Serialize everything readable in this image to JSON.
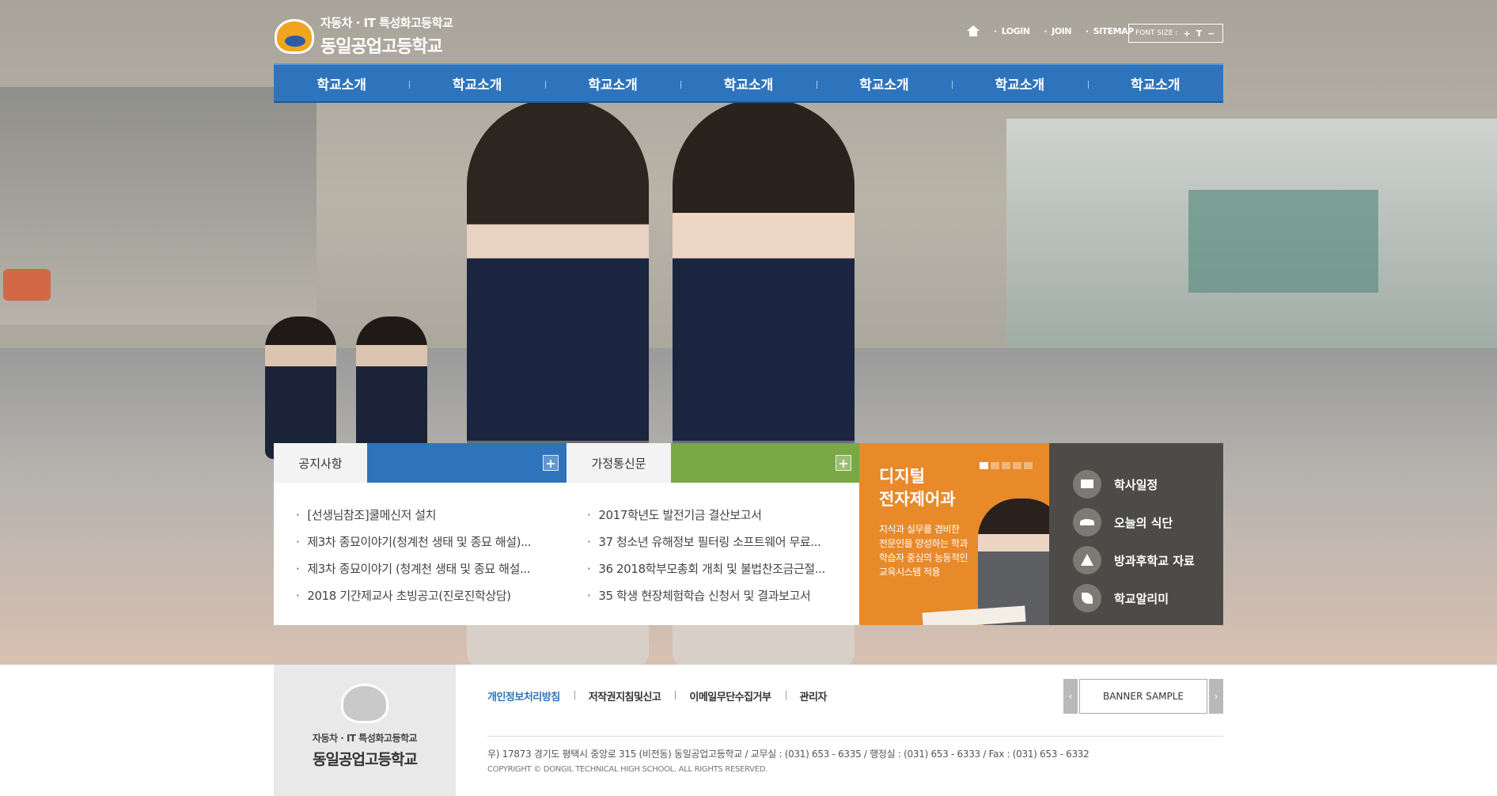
{
  "header": {
    "logo_sub": "자동차 · IT 특성화고등학교",
    "logo_main": "동일공업고등학교",
    "util_links": [
      "LOGIN",
      "JOIN",
      "SITEMAP"
    ],
    "font_size_label": "FONT SIZE :",
    "font_plus": "+",
    "font_reset": "T",
    "font_minus": "−"
  },
  "nav": {
    "items": [
      "학교소개",
      "학교소개",
      "학교소개",
      "학교소개",
      "학교소개",
      "학교소개",
      "학교소개"
    ]
  },
  "boards": {
    "notice": {
      "title": "공지사항",
      "items": [
        "[선생님참조]쿨메신저 설치",
        "제3차 종묘이야기(청계천 생태 및 종묘 해설)...",
        "제3차 종묘이야기 (청계천 생태 및 종묘 해설...",
        "2018 기간제교사 초빙공고(진로진학상담)"
      ]
    },
    "newsletter": {
      "title": "가정통신문",
      "items": [
        "2017학년도 발전기금 결산보고서",
        "37 청소년 유해정보 필터링 소프트웨어 무료...",
        "36 2018학부모총회 개최 및 불법찬조금근절...",
        "35 학생 현장체험학습 신청서 및 결과보고서"
      ]
    }
  },
  "promo": {
    "title": "디지털\n전자제어과",
    "desc": "지식과 실무를 겸비한\n전문인을 양성하는 학과\n학습자 중심의 능동적인\n교육시스템 적용",
    "slide_count": 5,
    "active_slide": 1
  },
  "quick_links": [
    {
      "label": "학사일정",
      "icon": "calendar-icon"
    },
    {
      "label": "오늘의 식단",
      "icon": "meal-icon"
    },
    {
      "label": "방과후학교 자료",
      "icon": "flask-icon"
    },
    {
      "label": "학교알리미",
      "icon": "leaf-icon"
    }
  ],
  "footer": {
    "logo_sub": "자동차 · IT 특성화고등학교",
    "logo_main": "동일공업고등학교",
    "links": [
      "개인정보처리방침",
      "저작권지침및신고",
      "이메일무단수집거부",
      "관리자"
    ],
    "banner": "BANNER SAMPLE",
    "banner_prev": "‹",
    "banner_next": "›",
    "address": "우) 17873 경기도 평택시 중앙로 315 (비전동) 동일공업고등학교 / 교무실 : (031) 653 - 6335 / 행정실 : (031) 653 - 6333 / Fax : (031) 653 - 6332",
    "copyright": "COPYRIGHT © DONGIL TECHNICAL HIGH SCHOOL. ALL RIGHTS RESERVED."
  },
  "colors": {
    "nav_blue": "#2e74bd",
    "newsletter_green": "#79a844",
    "promo_orange": "#e8892a",
    "quick_gray": "#4d4b47"
  }
}
